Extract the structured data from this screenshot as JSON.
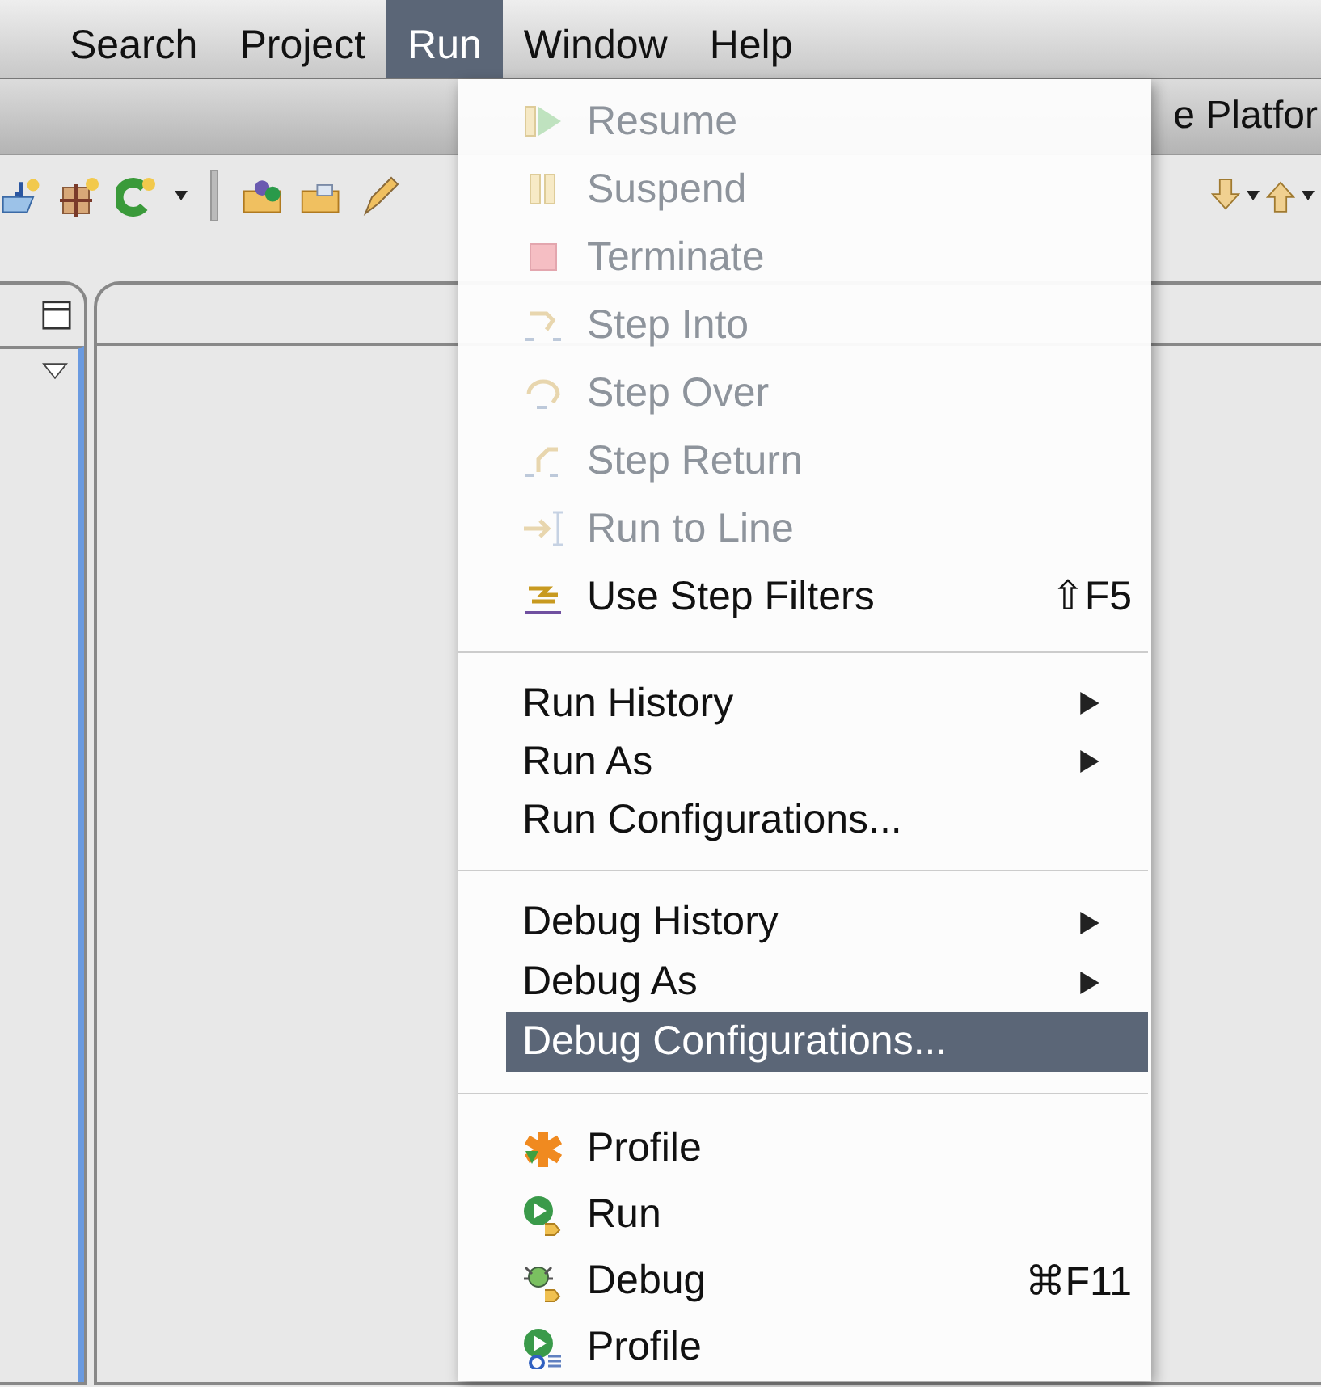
{
  "menu_bar": [
    {
      "label": "Search",
      "selected": false
    },
    {
      "label": "Project",
      "selected": false
    },
    {
      "label": "Run",
      "selected": true
    },
    {
      "label": "Window",
      "selected": false
    },
    {
      "label": "Help",
      "selected": false
    }
  ],
  "window": {
    "title": "e Platfor"
  },
  "run_menu": {
    "sections": [
      [
        {
          "label": "Resume",
          "disabled": true,
          "submenu": false,
          "selected": false
        },
        {
          "label": "Suspend",
          "disabled": true,
          "submenu": false,
          "selected": false
        },
        {
          "label": "Terminate",
          "disabled": true,
          "submenu": false,
          "selected": false
        },
        {
          "label": "Step Into",
          "disabled": true,
          "submenu": false,
          "selected": false
        },
        {
          "label": "Step Over",
          "disabled": true,
          "submenu": false,
          "selected": false
        },
        {
          "label": "Step Return",
          "disabled": true,
          "submenu": false,
          "selected": false
        },
        {
          "label": "Run to Line",
          "disabled": true,
          "submenu": false,
          "selected": false
        },
        {
          "label": "Use Step Filters",
          "shortcut": "⇧F5",
          "disabled": false,
          "submenu": false,
          "selected": false
        }
      ],
      [
        {
          "label": "Run History",
          "disabled": false,
          "submenu": true,
          "selected": false
        },
        {
          "label": "Run As",
          "disabled": false,
          "submenu": true,
          "selected": false
        },
        {
          "label": "Run Configurations...",
          "disabled": false,
          "submenu": false,
          "selected": false
        }
      ],
      [
        {
          "label": "Debug History",
          "disabled": false,
          "submenu": true,
          "selected": false
        },
        {
          "label": "Debug As",
          "disabled": false,
          "submenu": true,
          "selected": false
        },
        {
          "label": "Debug Configurations...",
          "disabled": false,
          "submenu": false,
          "selected": true
        }
      ],
      [
        {
          "label": "Profile",
          "disabled": false,
          "submenu": false,
          "selected": false
        },
        {
          "label": "Run",
          "disabled": false,
          "submenu": false,
          "selected": false
        },
        {
          "label": "Debug",
          "shortcut": "⌘F11",
          "disabled": false,
          "submenu": false,
          "selected": false
        },
        {
          "label": "Profile",
          "disabled": false,
          "submenu": false,
          "selected": false
        }
      ]
    ]
  }
}
